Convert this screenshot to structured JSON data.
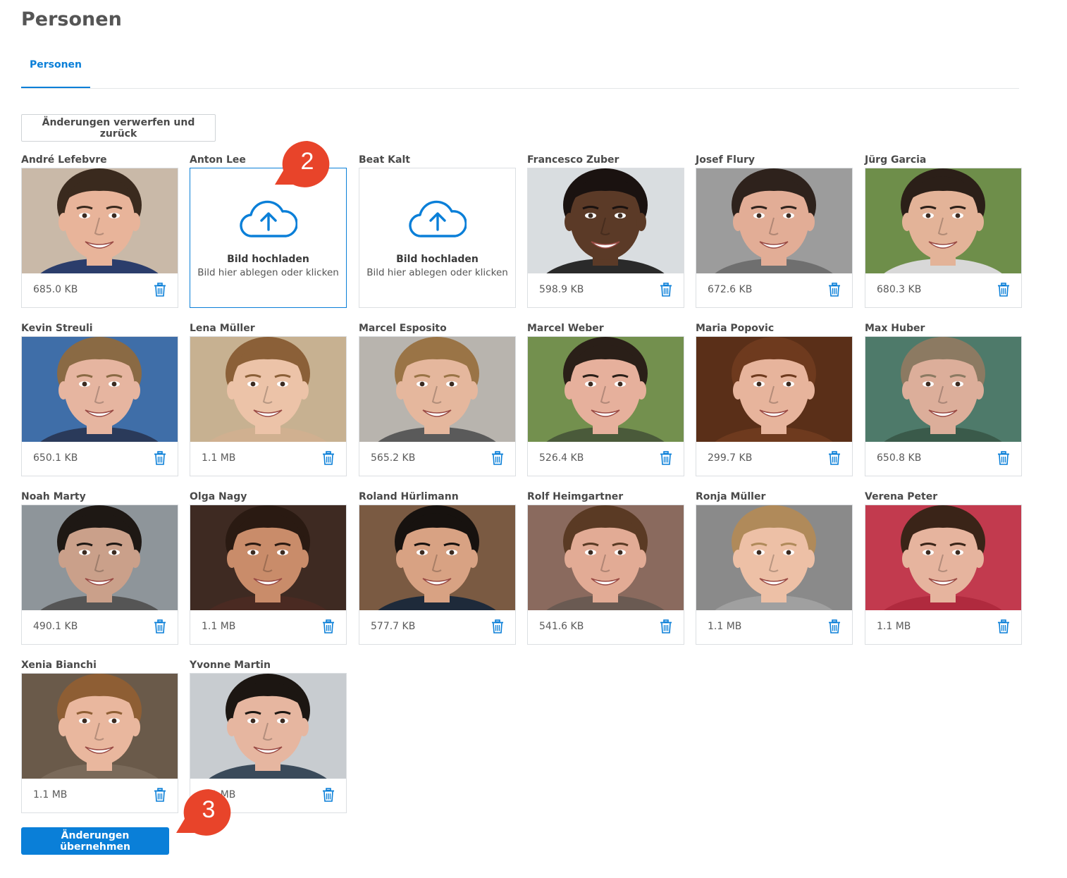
{
  "page": {
    "title": "Personen",
    "tabs": [
      {
        "label": "Personen",
        "active": true
      }
    ],
    "discard_button": "Änderungen verwerfen und zurück",
    "apply_button": "Änderungen übernehmen",
    "accent_color": "#0a7fd8",
    "callout_color": "#e8442a"
  },
  "upload": {
    "title": "Bild hochladen",
    "subtitle": "Bild hier ablegen oder klicken"
  },
  "persons": [
    {
      "name": "André Lefebvre",
      "size": "685.0 KB",
      "has_image": true,
      "skin": "#e8b49a",
      "hair": "#3a2a1e",
      "bg": "#c9b9a8",
      "shirt": "#2b3d6b"
    },
    {
      "name": "Anton Lee",
      "size": "",
      "has_image": false,
      "active": true
    },
    {
      "name": "Beat Kalt",
      "size": "",
      "has_image": false
    },
    {
      "name": "Francesco Zuber",
      "size": "598.9 KB",
      "has_image": true,
      "skin": "#5b3a27",
      "hair": "#1a1210",
      "bg": "#d9dde0",
      "shirt": "#2a2a2a"
    },
    {
      "name": "Josef Flury",
      "size": "672.6 KB",
      "has_image": true,
      "skin": "#e2ad96",
      "hair": "#2e221c",
      "bg": "#9c9c9c",
      "shirt": "#6f6f6f"
    },
    {
      "name": "Jürg Garcia",
      "size": "680.3 KB",
      "has_image": true,
      "skin": "#e3b398",
      "hair": "#2b1f18",
      "bg": "#6e8e4a",
      "shirt": "#d8d8d8"
    },
    {
      "name": "Kevin Streuli",
      "size": "650.1 KB",
      "has_image": true,
      "skin": "#e6b5a0",
      "hair": "#8a6a44",
      "bg": "#3f6ea8",
      "shirt": "#2a3a5a"
    },
    {
      "name": "Lena Müller",
      "size": "1.1 MB",
      "has_image": true,
      "skin": "#ecc3a8",
      "hair": "#8b6038",
      "bg": "#c7b191",
      "shirt": "#d0b090"
    },
    {
      "name": "Marcel Esposito",
      "size": "565.2 KB",
      "has_image": true,
      "skin": "#e5b79d",
      "hair": "#9a7446",
      "bg": "#b8b4ae",
      "shirt": "#5a5a5a"
    },
    {
      "name": "Marcel Weber",
      "size": "526.4 KB",
      "has_image": true,
      "skin": "#e6b09c",
      "hair": "#2a1f18",
      "bg": "#73904e",
      "shirt": "#4a5a3a"
    },
    {
      "name": "Maria Popovic",
      "size": "299.7 KB",
      "has_image": true,
      "skin": "#e7b49c",
      "hair": "#6e3a1e",
      "bg": "#5a2f18",
      "shirt": "#6e3a1e"
    },
    {
      "name": "Max Huber",
      "size": "650.8 KB",
      "has_image": true,
      "skin": "#dcae9a",
      "hair": "#8c7a62",
      "bg": "#4e7a6a",
      "shirt": "#3a5a4a"
    },
    {
      "name": "Noah Marty",
      "size": "490.1 KB",
      "has_image": true,
      "skin": "#caa08a",
      "hair": "#1e1814",
      "bg": "#8e959a",
      "shirt": "#555"
    },
    {
      "name": "Olga Nagy",
      "size": "1.1 MB",
      "has_image": true,
      "skin": "#c98c6a",
      "hair": "#2a1a12",
      "bg": "#3e2a22",
      "shirt": "#4a2a22"
    },
    {
      "name": "Roland Hürlimann",
      "size": "577.7 KB",
      "has_image": true,
      "skin": "#d8a283",
      "hair": "#17120f",
      "bg": "#7a5a42",
      "shirt": "#1e2a3a"
    },
    {
      "name": "Rolf Heimgartner",
      "size": "541.6 KB",
      "has_image": true,
      "skin": "#e2ab95",
      "hair": "#5a3a24",
      "bg": "#8a6a5e",
      "shirt": "#6a5a52"
    },
    {
      "name": "Ronja Müller",
      "size": "1.1 MB",
      "has_image": true,
      "skin": "#edc0a6",
      "hair": "#b08a5a",
      "bg": "#8a8a8a",
      "shirt": "#a0a0a0"
    },
    {
      "name": "Verena Peter",
      "size": "1.1 MB",
      "has_image": true,
      "skin": "#e6b49e",
      "hair": "#3a2418",
      "bg": "#c23a4e",
      "shirt": "#b02a3e"
    },
    {
      "name": "Xenia Bianchi",
      "size": "1.1 MB",
      "has_image": true,
      "skin": "#e9b79e",
      "hair": "#8e5e34",
      "bg": "#6a5a4a",
      "shirt": "#7a6a5a"
    },
    {
      "name": "Yvonne Martin",
      "size": "1.1 MB",
      "has_image": true,
      "skin": "#e6b6a0",
      "hair": "#1c1612",
      "bg": "#c8ccd0",
      "shirt": "#3a4a5a"
    }
  ],
  "callouts": [
    {
      "number": "2"
    },
    {
      "number": "3"
    }
  ]
}
